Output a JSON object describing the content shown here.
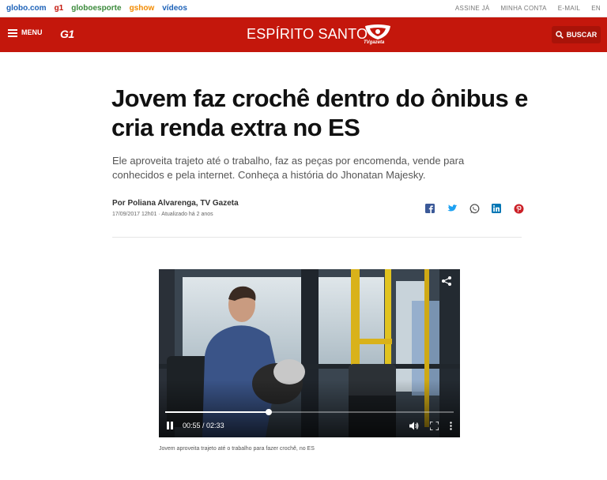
{
  "topbar": {
    "links": [
      {
        "label": "globo.com",
        "color": "#1d62b8"
      },
      {
        "label": "g1",
        "color": "#c4170c"
      },
      {
        "label": "globoesporte",
        "color": "#3b8a3b"
      },
      {
        "label": "gshow",
        "color": "#f28a00"
      },
      {
        "label": "vídeos",
        "color": "#1d62b8"
      }
    ],
    "right": [
      "ASSINE JÁ",
      "MINHA CONTA",
      "E-MAIL",
      "EN"
    ]
  },
  "header": {
    "menu_label": "MENU",
    "logo": "G1",
    "region": "ESPÍRITO SANTO",
    "tv_logo_text": "TVgazeta",
    "search_label": "BUSCAR",
    "brand_color": "#c4170c"
  },
  "article": {
    "title": "Jovem faz crochê dentro do ônibus e cria renda extra no ES",
    "subtitle": "Ele aproveita trajeto até o trabalho, faz as peças por encomenda, vende para conhecidos e pela internet. Conheça a história do Jhonatan Majesky.",
    "byline": "Por Poliana Alvarenga, TV Gazeta",
    "date": "17/09/2017 12h01 · Atualizado há 2 anos",
    "share": [
      {
        "name": "facebook-icon",
        "color": "#3b5998"
      },
      {
        "name": "twitter-icon",
        "color": "#1da1f2"
      },
      {
        "name": "whatsapp-icon",
        "color": "#555555"
      },
      {
        "name": "linkedin-icon",
        "color": "#0077b5"
      },
      {
        "name": "pinterest-icon",
        "color": "#cb2027"
      }
    ]
  },
  "video": {
    "current_time": "00:55",
    "separator": " / ",
    "duration": "02:33",
    "progress": 0.36,
    "caption": "Jovem aproveita trajeto até o trabalho para fazer crochê, no ES"
  }
}
